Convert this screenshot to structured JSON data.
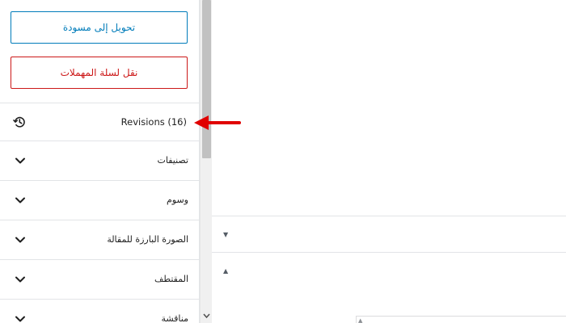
{
  "sidebar": {
    "switch_to_draft": "تحويل إلى مسودة",
    "move_to_trash": "نقل لسلة المهملات",
    "revisions": "Revisions (16)",
    "panels": [
      {
        "label": "تصنيفات"
      },
      {
        "label": "وسوم"
      },
      {
        "label": "الصورة البارزة للمقالة"
      },
      {
        "label": "المقتطف"
      },
      {
        "label": "مناقشة"
      }
    ]
  },
  "colors": {
    "primary": "#007cba",
    "destructive": "#cc1818",
    "annotation": "#e00000"
  },
  "icons": {
    "revisions": "history-icon",
    "panel_toggle": "chevron-down-icon"
  }
}
